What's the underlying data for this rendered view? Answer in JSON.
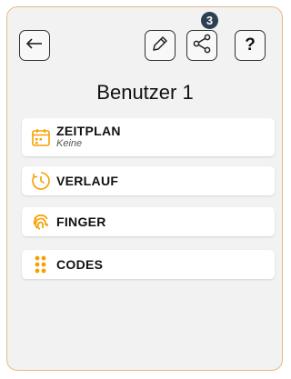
{
  "header": {
    "help_label": "?",
    "badge_count": "3",
    "title": "Benutzer 1"
  },
  "icons": {
    "back": "arrow-left-icon",
    "edit": "pencil-icon",
    "share": "share-icon",
    "schedule": "calendar-icon",
    "history": "clock-icon",
    "finger": "fingerprint-icon",
    "codes": "keypad-icon"
  },
  "colors": {
    "accent": "#f5a000",
    "border": "#e8b98a",
    "badge": "#2d3f52"
  },
  "menu": {
    "schedule": {
      "label": "ZEITPLAN",
      "value": "Keine"
    },
    "history": {
      "label": "VERLAUF"
    },
    "finger": {
      "label": "FINGER"
    },
    "codes": {
      "label": "CODES"
    }
  }
}
